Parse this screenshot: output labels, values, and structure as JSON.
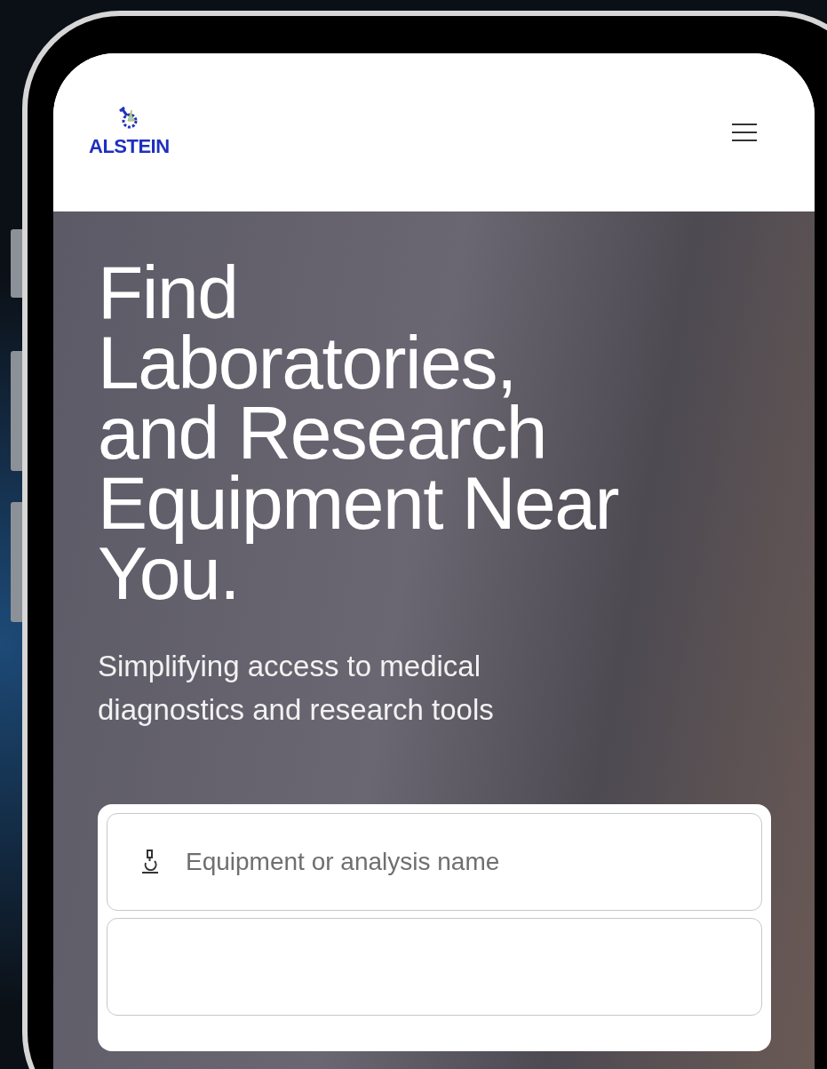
{
  "header": {
    "logo_text": "ALSTEIN"
  },
  "hero": {
    "title": "Find Laboratories, and Research Equipment Near You.",
    "subtitle": "Simplifying access to medical diagnostics and research tools"
  },
  "search": {
    "fields": [
      {
        "placeholder": "Equipment or analysis name"
      }
    ]
  }
}
